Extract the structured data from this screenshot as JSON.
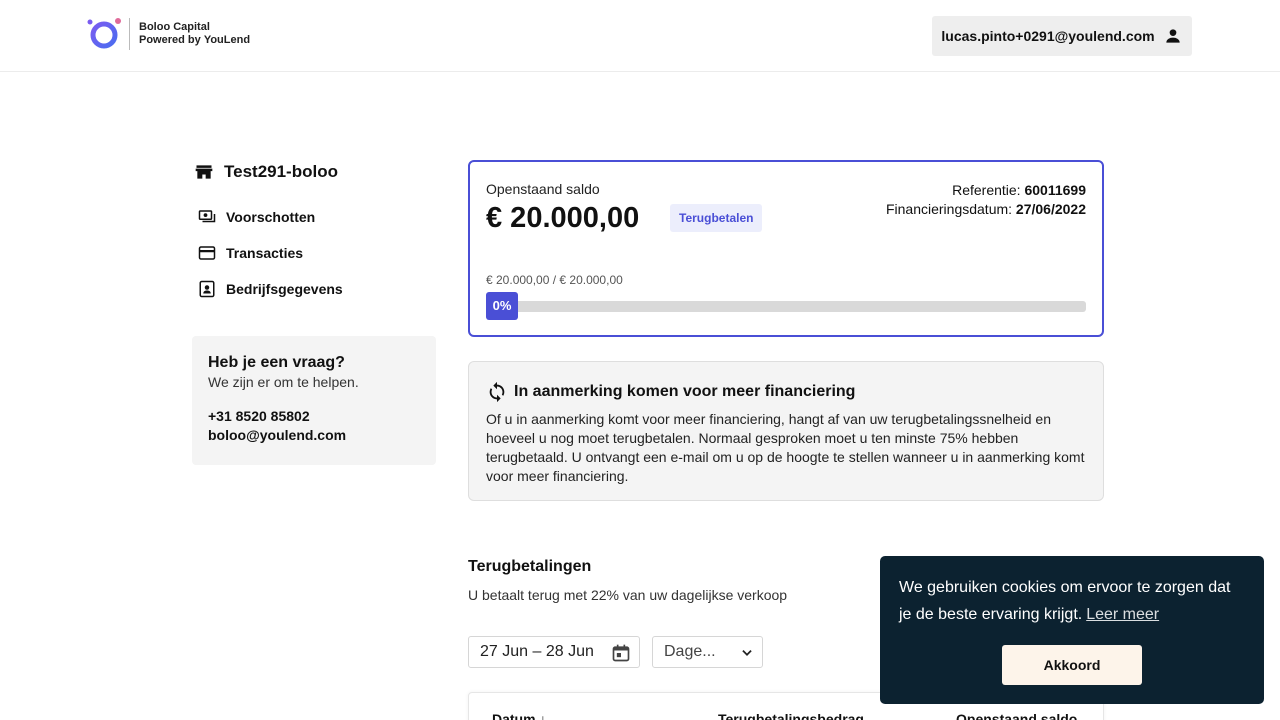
{
  "header": {
    "logo_line1": "Boloo Capital",
    "logo_line2": "Powered by",
    "logo_line2_brand": "YouLend",
    "user_email": "lucas.pinto+0291@youlend.com",
    "brand_color": "#4a4fd6"
  },
  "sidebar": {
    "company": "Test291-boloo",
    "items": [
      {
        "label": "Voorschotten",
        "icon": "money-icon"
      },
      {
        "label": "Transacties",
        "icon": "card-icon"
      },
      {
        "label": "Bedrijfsgegevens",
        "icon": "contact-icon"
      }
    ],
    "help": {
      "title": "Heb je een vraag?",
      "subtitle": "We zijn er om te helpen.",
      "phone": "+31 8520 85802",
      "email": "boloo@youlend.com"
    }
  },
  "balance": {
    "label": "Openstaand saldo",
    "amount": "€ 20.000,00",
    "badge": "Terugbetalen",
    "reference_label": "Referentie:",
    "reference_value": "60011699",
    "date_label": "Financieringsdatum:",
    "date_value": "27/06/2022",
    "progress_text": "€ 20.000,00 / € 20.000,00",
    "progress_percent_label": "0%",
    "progress_fraction": 0
  },
  "info": {
    "title": "In aanmerking komen voor meer financiering",
    "body": "Of u in aanmerking komt voor meer financiering, hangt af van uw terugbetalingssnelheid en hoeveel u nog moet terugbetalen. Normaal gesproken moet u ten minste 75% hebben terugbetaald. U ontvangt een e-mail om u op de hoogte te stellen wanneer u in aanmerking komt voor meer financiering."
  },
  "repayments": {
    "title": "Terugbetalingen",
    "subtitle": "U betaalt terug met 22% van uw dagelijkse verkoop",
    "date_range": "27 Jun – 28 Jun",
    "period_select": "Dage...",
    "columns": [
      "Datum",
      "Terugbetalingsbedrag",
      "Openstaand saldo"
    ]
  },
  "cookie": {
    "text": "We gebruiken cookies om ervoor te zorgen dat je de beste ervaring krijgt.",
    "link": "Leer meer",
    "button": "Akkoord"
  }
}
